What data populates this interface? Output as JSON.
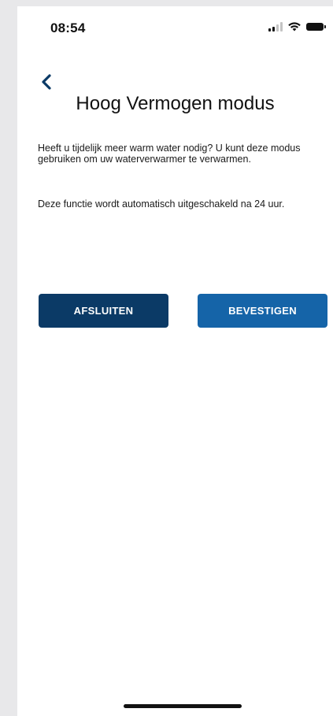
{
  "status_bar": {
    "time": "08:54",
    "icons": [
      "cellular-signal-icon",
      "wifi-icon",
      "battery-icon"
    ]
  },
  "nav": {
    "back_icon": "chevron-left-icon"
  },
  "page": {
    "title": "Hoog Vermogen modus",
    "paragraph_1": "Heeft u tijdelijk meer warm water nodig? U kunt deze modus gebruiken om uw waterverwarmer te verwarmen.",
    "paragraph_2": "Deze functie wordt automatisch uitgeschakeld na 24 uur."
  },
  "actions": {
    "close_label": "AFSLUITEN",
    "confirm_label": "BEVESTIGEN"
  },
  "colors": {
    "accent_dark": "#0b3a66",
    "accent": "#1564a8",
    "back_chevron": "#0b3a66"
  }
}
